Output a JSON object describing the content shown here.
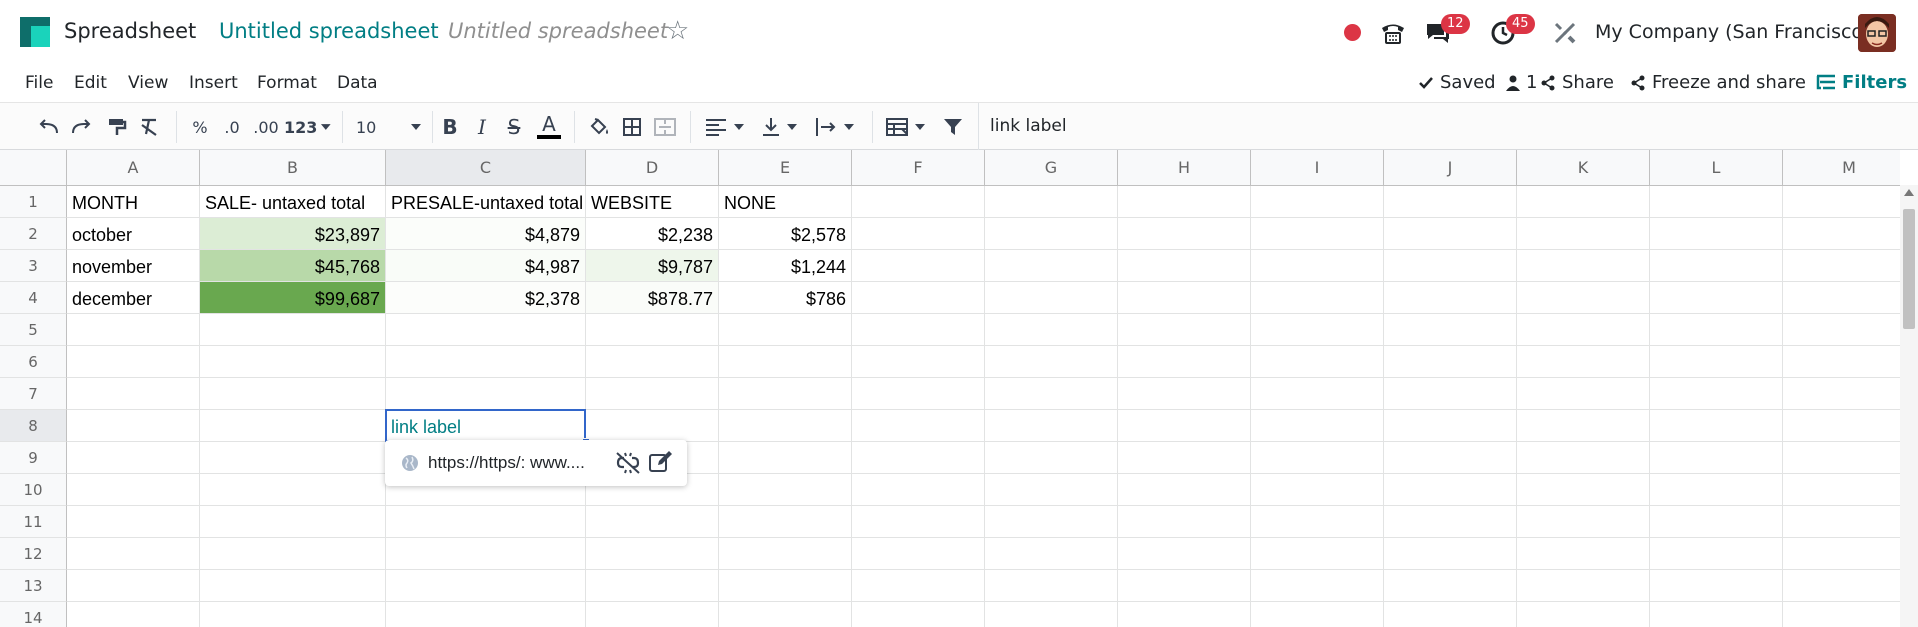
{
  "navbar": {
    "app_name": "Spreadsheet",
    "doc_title": "Untitled spreadsheet",
    "doc_title_input": "Untitled spreadsheet",
    "chat_badge": "12",
    "activity_badge": "45",
    "company": "My Company (San Francisco)"
  },
  "menubar": {
    "items": [
      "File",
      "Edit",
      "View",
      "Insert",
      "Format",
      "Data"
    ],
    "saved": "Saved",
    "users_count": "1",
    "share": "Share",
    "freeze_share": "Freeze and share",
    "filters": "Filters"
  },
  "toolbar": {
    "percent": "%",
    "dec_decrease": ".0",
    "dec_increase": ".00",
    "format_more": "123",
    "font_size": "10",
    "bold": "B",
    "italic": "I",
    "strike": "S",
    "text_color": "A",
    "formula_value": "link label"
  },
  "grid": {
    "columns": [
      "A",
      "B",
      "C",
      "D",
      "E",
      "F",
      "G",
      "H",
      "I",
      "J",
      "K",
      "L",
      "M"
    ],
    "rows": [
      "1",
      "2",
      "3",
      "4",
      "5",
      "6",
      "7",
      "8",
      "9",
      "10",
      "11",
      "12",
      "13",
      "14"
    ],
    "cells": {
      "A1": "MONTH",
      "B1": "SALE- untaxed total",
      "C1": "PRESALE-untaxed total",
      "D1": "WEBSITE",
      "E1": "NONE",
      "A2": "october",
      "B2": "$23,897",
      "C2": "$4,879",
      "D2": "$2,238",
      "E2": "$2,578",
      "A3": "november",
      "B3": "$45,768",
      "C3": "$4,987",
      "D3": "$9,787",
      "E3": "$1,244",
      "A4": "december",
      "B4": "$99,687",
      "C4": "$2,378",
      "D4": "$878.77",
      "E4": "$786",
      "C8": "link label"
    },
    "fills": {
      "B2": "#dcedd5",
      "B3": "#b8d9a9",
      "B4": "#69a84f",
      "C2": "#fbfdfa",
      "C3": "#f9fcf8",
      "C4": "#fcfdfb",
      "D3": "#eef6eb",
      "D4": "#fafcf9"
    },
    "selected_cell": "C8"
  },
  "link_popover": {
    "url": "https://https/: www...."
  },
  "colors": {
    "accent": "#017e84",
    "selection": "#3266ca",
    "badge": "#dc3545"
  }
}
